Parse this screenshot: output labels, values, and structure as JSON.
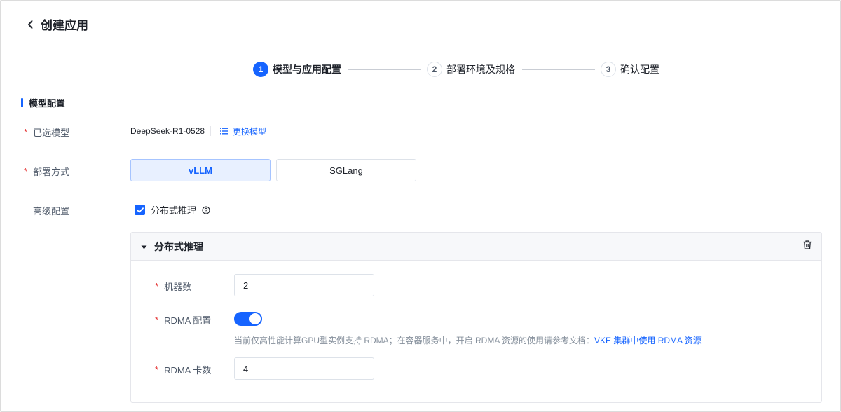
{
  "header": {
    "title": "创建应用",
    "back_icon": "chevron-left-icon"
  },
  "steps": [
    {
      "num": "1",
      "label": "模型与应用配置",
      "state": "active"
    },
    {
      "num": "2",
      "label": "部署环境及规格",
      "state": "pending"
    },
    {
      "num": "3",
      "label": "确认配置",
      "state": "pending"
    }
  ],
  "section": {
    "title": "模型配置"
  },
  "form": {
    "model": {
      "label": "已选模型",
      "value": "DeepSeek-R1-0528",
      "change_label": "更换模型",
      "change_icon": "list-icon"
    },
    "deploy": {
      "label": "部署方式",
      "options": [
        "vLLM",
        "SGLang"
      ],
      "selected": "vLLM"
    },
    "advanced": {
      "label": "高级配置",
      "checkbox_label": "分布式推理",
      "checked": true,
      "help_icon": "question-circle-icon"
    }
  },
  "panel": {
    "title": "分布式推理",
    "machines": {
      "label": "机器数",
      "value": "2"
    },
    "rdma": {
      "label": "RDMA 配置",
      "enabled": true
    },
    "hint": {
      "text": "当前仅高性能计算GPU型实例支持 RDMA；在容器服务中，开启 RDMA 资源的使用请参考文档：",
      "link": "VKE 集群中使用 RDMA 资源"
    },
    "rdma_cards": {
      "label": "RDMA 卡数",
      "value": "4"
    }
  },
  "colors": {
    "primary": "#1664ff",
    "required": "#e63a3a"
  }
}
